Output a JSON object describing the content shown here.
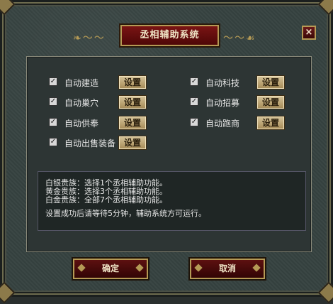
{
  "dialog": {
    "title": "丞相辅助系统",
    "close_label": "×"
  },
  "options_left": [
    {
      "label": "自动建造",
      "checked": true,
      "button": "设置"
    },
    {
      "label": "自动巢穴",
      "checked": true,
      "button": "设置"
    },
    {
      "label": "自动供奉",
      "checked": true,
      "button": "设置"
    },
    {
      "label": "自动出售装备",
      "checked": true,
      "button": "设置"
    }
  ],
  "options_right": [
    {
      "label": "自动科技",
      "checked": true,
      "button": "设置"
    },
    {
      "label": "自动招募",
      "checked": true,
      "button": "设置"
    },
    {
      "label": "自动跑商",
      "checked": true,
      "button": "设置"
    }
  ],
  "info": {
    "lines": [
      "白银贵族：选择1个丞相辅助功能。",
      "黄金贵族：选择3个丞相辅助功能。",
      "白金贵族：全部7个丞相辅助功能。"
    ],
    "note": "设置成功后请等待5分钟，辅助系统方可运行。"
  },
  "footer": {
    "confirm_label": "确定",
    "cancel_label": "取消"
  }
}
